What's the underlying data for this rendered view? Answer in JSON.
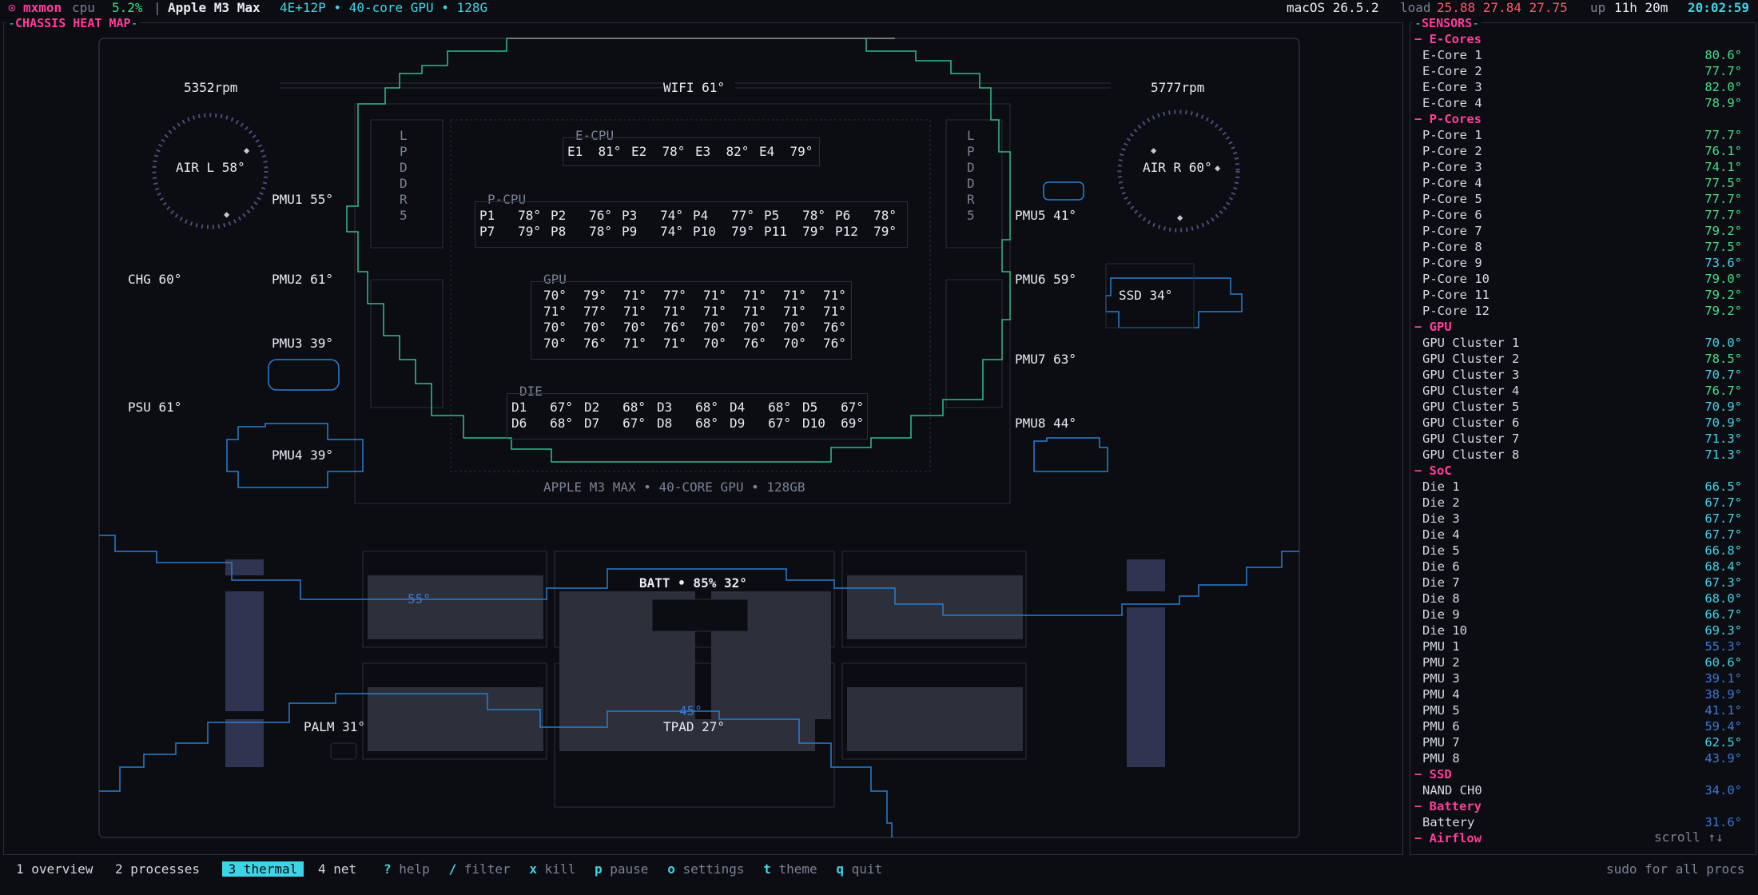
{
  "topbar": {
    "app_glyph": "⊙",
    "app_name": "mxmon",
    "mode": "cpu",
    "cpu_pct": "5.2%",
    "sep": "|",
    "model": "Apple M3 Max",
    "spec": "4E+12P • 40-core GPU • 128G",
    "os": "macOS 26.5.2",
    "load_label": "load",
    "load_values": "25.88 27.84 27.75",
    "up_label": "up",
    "uptime": "11h 20m",
    "clock": "20:02:59"
  },
  "heatmap": {
    "title": "CHASSIS HEAT MAP",
    "fan_left_rpm": "5352rpm",
    "fan_right_rpm": "5777rpm",
    "wifi": "WIFI 61°",
    "air_left": "AIR L 58°",
    "air_right": "AIR R 60°",
    "chg": "CHG 60°",
    "psu": "PSU 61°",
    "pmu1": "PMU1 55°",
    "pmu2": "PMU2 61°",
    "pmu3": "PMU3 39°",
    "pmu4": "PMU4 39°",
    "pmu5": "PMU5 41°",
    "pmu6": "PMU6 59°",
    "pmu7": "PMU7 63°",
    "pmu8": "PMU8 44°",
    "ssd": "SSD 34°",
    "lpddr": "L\nP\nD\nD\nR\n5",
    "ecpu_label": "E-CPU",
    "ecpu_cells": [
      "E1  81°",
      "E2  78°",
      "E3  82°",
      "E4  79°"
    ],
    "pcpu_label": "P-CPU",
    "pcpu_cells": [
      [
        "P1   78°",
        "P2   76°",
        "P3   74°",
        "P4   77°",
        "P5   78°",
        "P6   78°"
      ],
      [
        "P7   79°",
        "P8   78°",
        "P9   74°",
        "P10  79°",
        "P11  79°",
        "P12  79°"
      ]
    ],
    "gpu_label": "GPU",
    "gpu_cells": [
      [
        "70°",
        "79°",
        "71°",
        "77°",
        "71°",
        "71°",
        "71°",
        "71°"
      ],
      [
        "71°",
        "77°",
        "71°",
        "71°",
        "71°",
        "71°",
        "71°",
        "71°"
      ],
      [
        "70°",
        "70°",
        "70°",
        "76°",
        "70°",
        "70°",
        "70°",
        "76°"
      ],
      [
        "70°",
        "76°",
        "71°",
        "71°",
        "70°",
        "76°",
        "70°",
        "76°"
      ]
    ],
    "die_label": "DIE",
    "die_cells": [
      [
        "D1   67°",
        "D2   68°",
        "D3   68°",
        "D4   68°",
        "D5   67°"
      ],
      [
        "D6   68°",
        "D7   67°",
        "D8   68°",
        "D9   67°",
        "D10  69°"
      ]
    ],
    "soc_caption": "APPLE M3 MAX • 40-CORE GPU • 128GB",
    "batt": "BATT • 85% 32°",
    "iso_55": "55°",
    "iso_45": "45°",
    "palm": "PALM 31°",
    "tpad": "TPAD 27°"
  },
  "sensors": {
    "title": "SENSORS",
    "groups": [
      {
        "name": "E-Cores",
        "items": [
          {
            "label": "E-Core 1",
            "value": "80.6°",
            "color": "#3ee08a"
          },
          {
            "label": "E-Core 2",
            "value": "77.7°",
            "color": "#3ee08a"
          },
          {
            "label": "E-Core 3",
            "value": "82.0°",
            "color": "#3ee08a"
          },
          {
            "label": "E-Core 4",
            "value": "78.9°",
            "color": "#3ee08a"
          }
        ]
      },
      {
        "name": "P-Cores",
        "items": [
          {
            "label": "P-Core 1",
            "value": "77.7°",
            "color": "#3ee08a"
          },
          {
            "label": "P-Core 2",
            "value": "76.1°",
            "color": "#3ee08a"
          },
          {
            "label": "P-Core 3",
            "value": "74.1°",
            "color": "#3ee08a"
          },
          {
            "label": "P-Core 4",
            "value": "77.5°",
            "color": "#3ee08a"
          },
          {
            "label": "P-Core 5",
            "value": "77.7°",
            "color": "#3ee08a"
          },
          {
            "label": "P-Core 6",
            "value": "77.7°",
            "color": "#3ee08a"
          },
          {
            "label": "P-Core 7",
            "value": "79.2°",
            "color": "#3ee08a"
          },
          {
            "label": "P-Core 8",
            "value": "77.5°",
            "color": "#3ee08a"
          },
          {
            "label": "P-Core 9",
            "value": "73.6°",
            "color": "#3dd5e6"
          },
          {
            "label": "P-Core 10",
            "value": "79.0°",
            "color": "#3ee08a"
          },
          {
            "label": "P-Core 11",
            "value": "79.2°",
            "color": "#3ee08a"
          },
          {
            "label": "P-Core 12",
            "value": "79.2°",
            "color": "#3ee08a"
          }
        ]
      },
      {
        "name": "GPU",
        "items": [
          {
            "label": "GPU Cluster 1",
            "value": "70.0°",
            "color": "#3dd5e6"
          },
          {
            "label": "GPU Cluster 2",
            "value": "78.5°",
            "color": "#3ee08a"
          },
          {
            "label": "GPU Cluster 3",
            "value": "70.7°",
            "color": "#3dd5e6"
          },
          {
            "label": "GPU Cluster 4",
            "value": "76.7°",
            "color": "#3ee08a"
          },
          {
            "label": "GPU Cluster 5",
            "value": "70.9°",
            "color": "#3dd5e6"
          },
          {
            "label": "GPU Cluster 6",
            "value": "70.9°",
            "color": "#3dd5e6"
          },
          {
            "label": "GPU Cluster 7",
            "value": "71.3°",
            "color": "#3dd5e6"
          },
          {
            "label": "GPU Cluster 8",
            "value": "71.3°",
            "color": "#3dd5e6"
          }
        ]
      },
      {
        "name": "SoC",
        "items": [
          {
            "label": "Die 1",
            "value": "66.5°",
            "color": "#3dd5e6"
          },
          {
            "label": "Die 2",
            "value": "67.7°",
            "color": "#3dd5e6"
          },
          {
            "label": "Die 3",
            "value": "67.7°",
            "color": "#3dd5e6"
          },
          {
            "label": "Die 4",
            "value": "67.7°",
            "color": "#3dd5e6"
          },
          {
            "label": "Die 5",
            "value": "66.8°",
            "color": "#3dd5e6"
          },
          {
            "label": "Die 6",
            "value": "68.4°",
            "color": "#3dd5e6"
          },
          {
            "label": "Die 7",
            "value": "67.3°",
            "color": "#3dd5e6"
          },
          {
            "label": "Die 8",
            "value": "68.0°",
            "color": "#3dd5e6"
          },
          {
            "label": "Die 9",
            "value": "66.7°",
            "color": "#3dd5e6"
          },
          {
            "label": "Die 10",
            "value": "69.3°",
            "color": "#3dd5e6"
          },
          {
            "label": "PMU 1",
            "value": "55.3°",
            "color": "#3b78d6"
          },
          {
            "label": "PMU 2",
            "value": "60.6°",
            "color": "#3dd5e6"
          },
          {
            "label": "PMU 3",
            "value": "39.1°",
            "color": "#3b78d6"
          },
          {
            "label": "PMU 4",
            "value": "38.9°",
            "color": "#3b78d6"
          },
          {
            "label": "PMU 5",
            "value": "41.1°",
            "color": "#3b78d6"
          },
          {
            "label": "PMU 6",
            "value": "59.4°",
            "color": "#3b78d6"
          },
          {
            "label": "PMU 7",
            "value": "62.5°",
            "color": "#3dd5e6"
          },
          {
            "label": "PMU 8",
            "value": "43.9°",
            "color": "#3b78d6"
          }
        ]
      },
      {
        "name": "SSD",
        "items": [
          {
            "label": "NAND CH0",
            "value": "34.0°",
            "color": "#3b78d6"
          }
        ]
      },
      {
        "name": "Battery",
        "items": [
          {
            "label": "Battery",
            "value": "31.6°",
            "color": "#3b78d6"
          }
        ]
      },
      {
        "name": "Airflow",
        "items": []
      }
    ],
    "scroll_hint": "scroll ↑↓"
  },
  "bottombar": {
    "tabs": [
      {
        "key": "1",
        "label": "overview",
        "active": false
      },
      {
        "key": "2",
        "label": "processes",
        "active": false
      },
      {
        "key": "3",
        "label": "thermal",
        "active": true
      },
      {
        "key": "4",
        "label": "net",
        "active": false
      }
    ],
    "actions": [
      {
        "key": "?",
        "label": "help"
      },
      {
        "key": "/",
        "label": "filter"
      },
      {
        "key": "x",
        "label": "kill"
      },
      {
        "key": "p",
        "label": "pause"
      },
      {
        "key": "o",
        "label": "settings"
      },
      {
        "key": "t",
        "label": "theme"
      },
      {
        "key": "q",
        "label": "quit"
      }
    ],
    "right_note": "sudo for all procs"
  }
}
